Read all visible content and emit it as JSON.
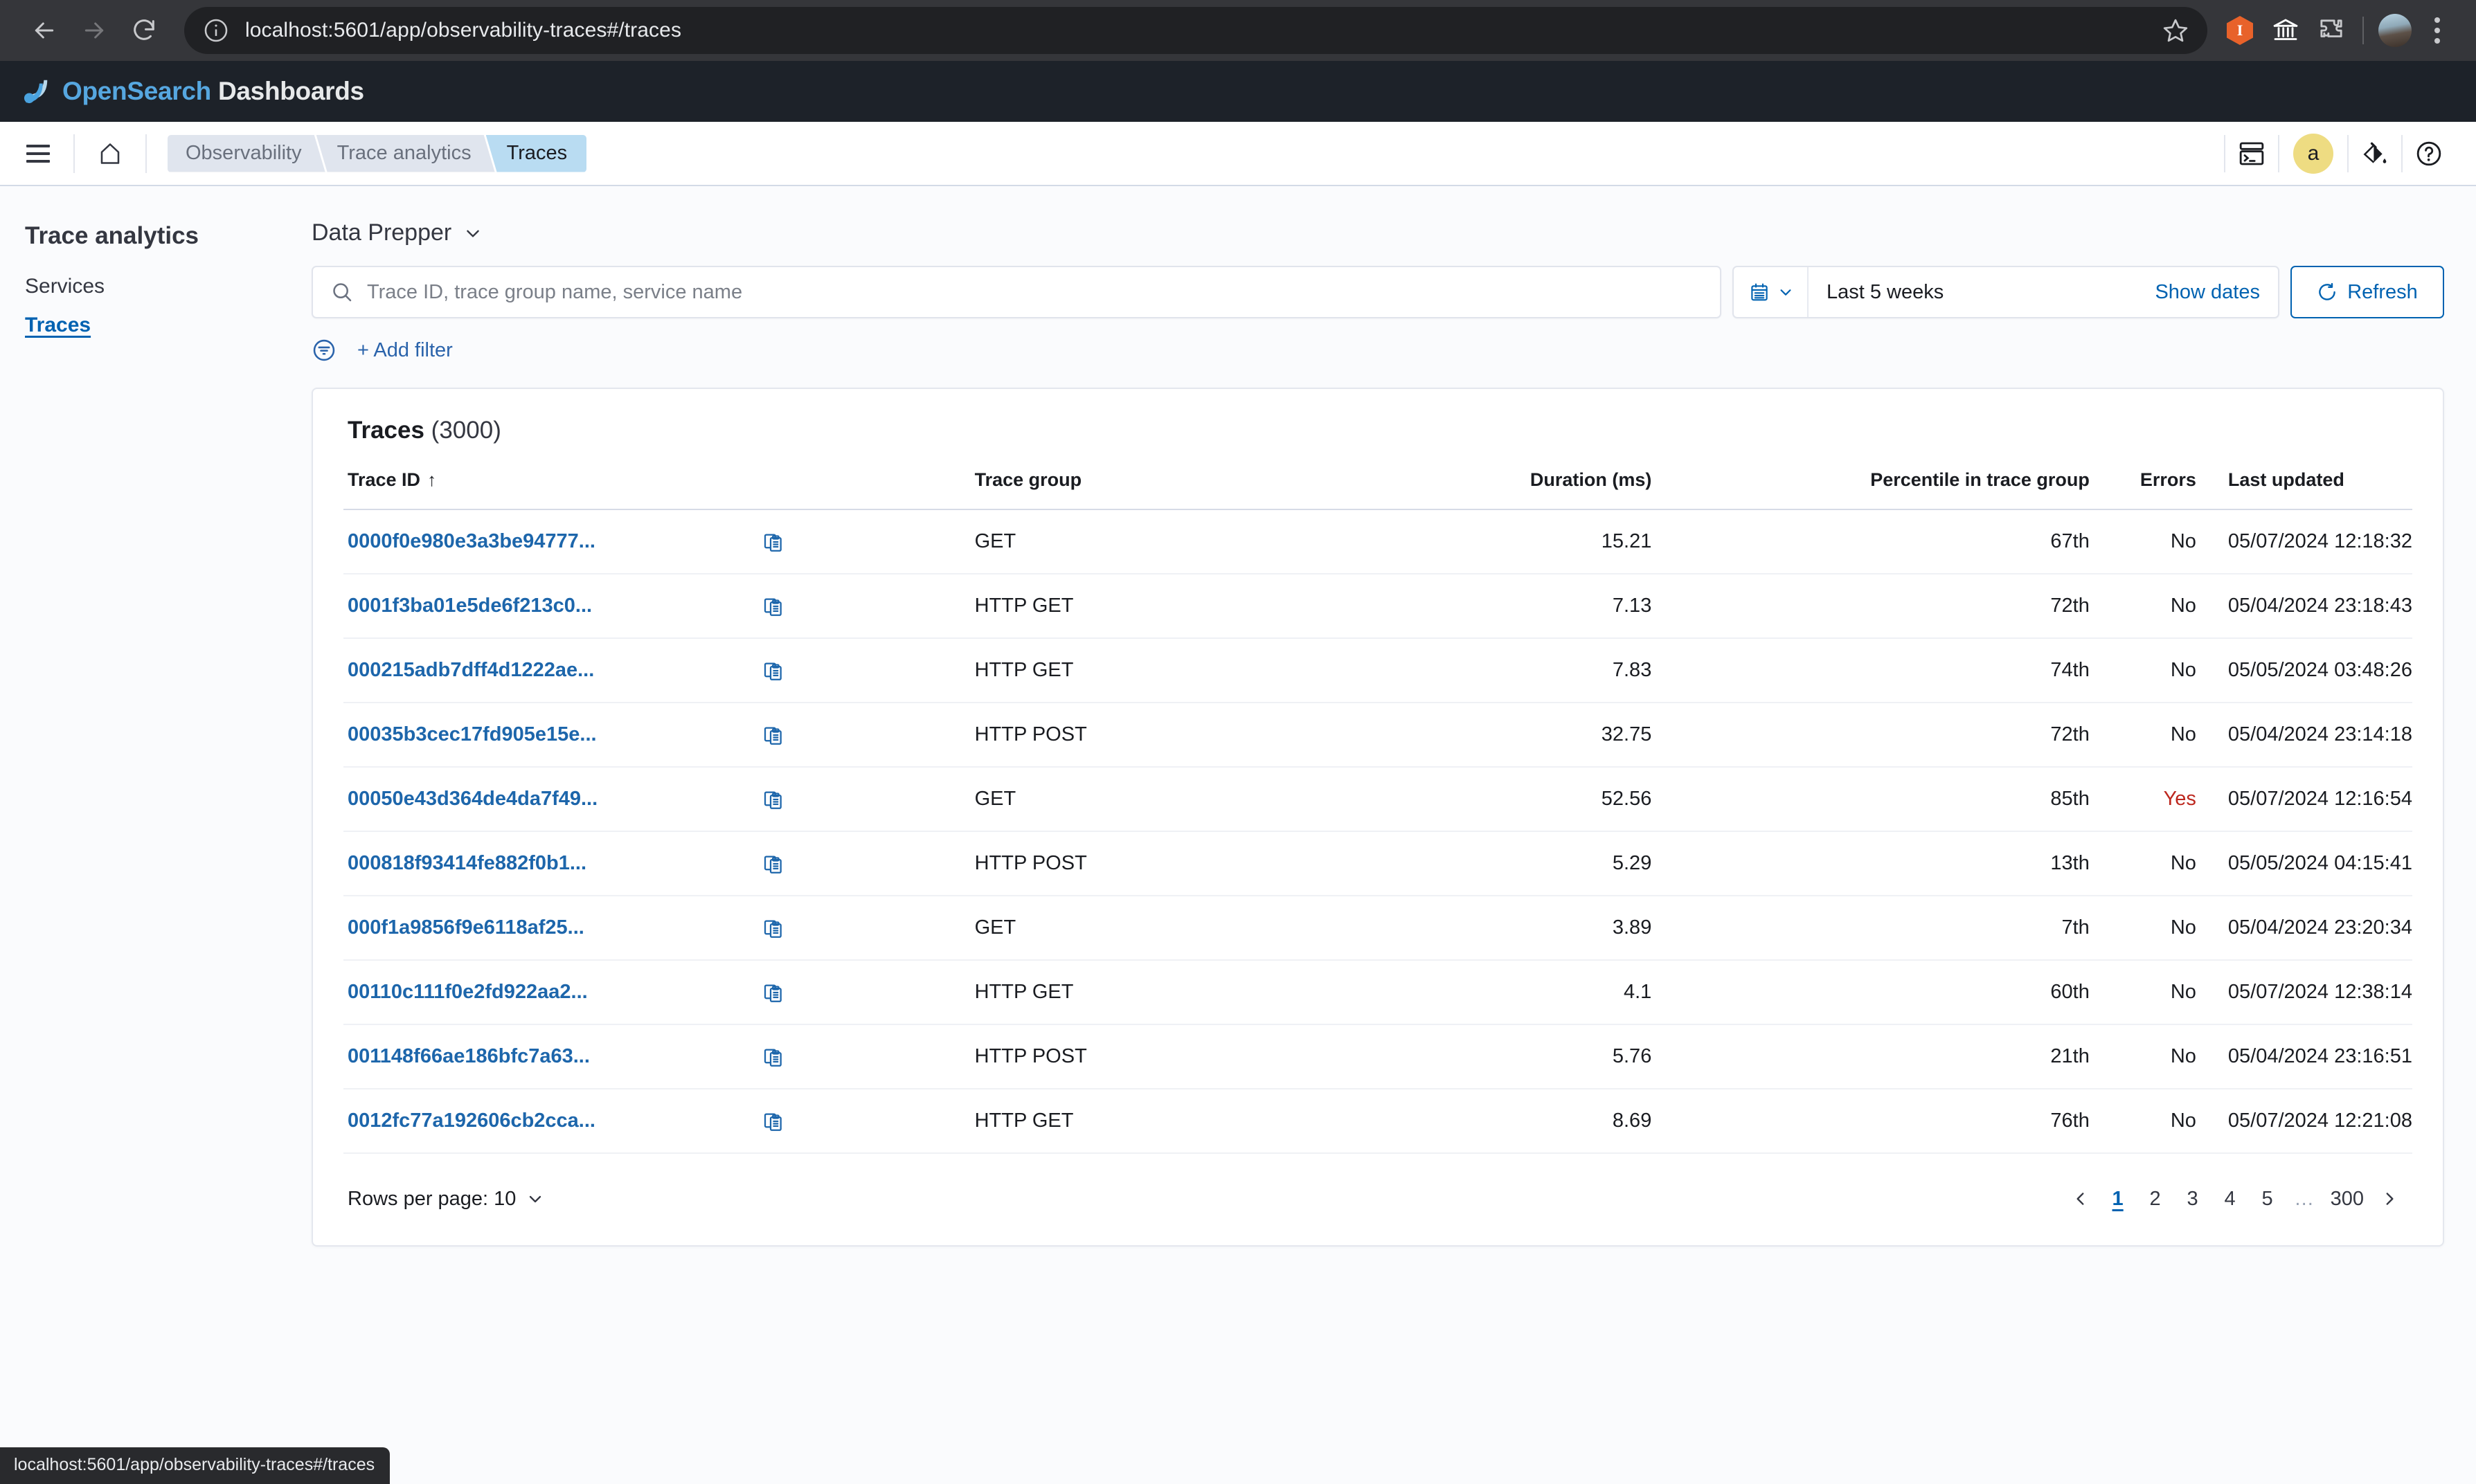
{
  "browser": {
    "url": "localhost:5601/app/observability-traces#/traces",
    "back_icon": "back-arrow-icon",
    "forward_icon": "forward-arrow-icon",
    "reload_icon": "reload-icon",
    "site_info_icon": "site-info-icon",
    "bookmark_icon": "star-icon",
    "extension_label": "I",
    "status_bar_url": "localhost:5601/app/observability-traces#/traces"
  },
  "osd_header": {
    "logo_brand": "OpenSearch",
    "logo_product": " Dashboards"
  },
  "nav": {
    "menu_icon": "hamburger-menu-icon",
    "home_icon": "home-icon",
    "breadcrumbs": [
      {
        "label": "Observability",
        "active": false
      },
      {
        "label": "Trace analytics",
        "active": false
      },
      {
        "label": "Traces",
        "active": true
      }
    ],
    "dev_tools_icon": "dev-console-icon",
    "avatar_initial": "a",
    "theme_icon": "paint-bucket-icon",
    "help_icon": "help-circle-icon"
  },
  "sidebar": {
    "title": "Trace analytics",
    "items": [
      {
        "label": "Services",
        "active": false
      },
      {
        "label": "Traces",
        "active": true
      }
    ]
  },
  "toolbar": {
    "source_label": "Data Prepper",
    "source_chevron_icon": "chevron-down-icon",
    "search_icon": "search-icon",
    "search_placeholder": "Trace ID, trace group name, service name",
    "calendar_icon": "calendar-icon",
    "date_value": "Last 5 weeks",
    "show_dates_label": "Show dates",
    "refresh_icon": "refresh-icon",
    "refresh_label": "Refresh",
    "filter_icon": "filter-icon",
    "add_filter_label": "+ Add filter"
  },
  "table": {
    "title": "Traces",
    "count_label": "(3000)",
    "sort_arrow": "↑",
    "copy_icon": "copy-clipboard-icon",
    "columns": {
      "trace_id": "Trace ID",
      "copy": "",
      "trace_group": "Trace group",
      "duration": "Duration (ms)",
      "percentile": "Percentile in trace group",
      "errors": "Errors",
      "last_updated": "Last updated"
    },
    "rows": [
      {
        "trace_id": "0000f0e980e3a3be94777...",
        "trace_group": "GET",
        "duration": "15.21",
        "percentile": "67th",
        "errors": "No",
        "last_updated": "05/07/2024 12:18:32"
      },
      {
        "trace_id": "0001f3ba01e5de6f213c0...",
        "trace_group": "HTTP GET",
        "duration": "7.13",
        "percentile": "72th",
        "errors": "No",
        "last_updated": "05/04/2024 23:18:43"
      },
      {
        "trace_id": "000215adb7dff4d1222ae...",
        "trace_group": "HTTP GET",
        "duration": "7.83",
        "percentile": "74th",
        "errors": "No",
        "last_updated": "05/05/2024 03:48:26"
      },
      {
        "trace_id": "00035b3cec17fd905e15e...",
        "trace_group": "HTTP POST",
        "duration": "32.75",
        "percentile": "72th",
        "errors": "No",
        "last_updated": "05/04/2024 23:14:18"
      },
      {
        "trace_id": "00050e43d364de4da7f49...",
        "trace_group": "GET",
        "duration": "52.56",
        "percentile": "85th",
        "errors": "Yes",
        "last_updated": "05/07/2024 12:16:54"
      },
      {
        "trace_id": "000818f93414fe882f0b1...",
        "trace_group": "HTTP POST",
        "duration": "5.29",
        "percentile": "13th",
        "errors": "No",
        "last_updated": "05/05/2024 04:15:41"
      },
      {
        "trace_id": "000f1a9856f9e6118af25...",
        "trace_group": "GET",
        "duration": "3.89",
        "percentile": "7th",
        "errors": "No",
        "last_updated": "05/04/2024 23:20:34"
      },
      {
        "trace_id": "00110c111f0e2fd922aa2...",
        "trace_group": "HTTP GET",
        "duration": "4.1",
        "percentile": "60th",
        "errors": "No",
        "last_updated": "05/07/2024 12:38:14"
      },
      {
        "trace_id": "001148f66ae186bfc7a63...",
        "trace_group": "HTTP POST",
        "duration": "5.76",
        "percentile": "21th",
        "errors": "No",
        "last_updated": "05/04/2024 23:16:51"
      },
      {
        "trace_id": "0012fc77a192606cb2cca...",
        "trace_group": "HTTP GET",
        "duration": "8.69",
        "percentile": "76th",
        "errors": "No",
        "last_updated": "05/07/2024 12:21:08"
      }
    ]
  },
  "pagination": {
    "rows_per_page_label": "Rows per page: 10",
    "prev_icon": "chevron-left-icon",
    "next_icon": "chevron-right-icon",
    "pages": [
      {
        "label": "1",
        "active": true
      },
      {
        "label": "2",
        "active": false
      },
      {
        "label": "3",
        "active": false
      },
      {
        "label": "4",
        "active": false
      },
      {
        "label": "5",
        "active": false
      },
      {
        "label": "…",
        "active": false
      },
      {
        "label": "300",
        "active": false
      }
    ]
  },
  "colors": {
    "accent_blue": "#0062b1",
    "link_blue": "#1d66ab",
    "error_red": "#bd271e",
    "avatar_yellow": "#eedc82",
    "breadcrumb_active": "#b9dcf2"
  }
}
